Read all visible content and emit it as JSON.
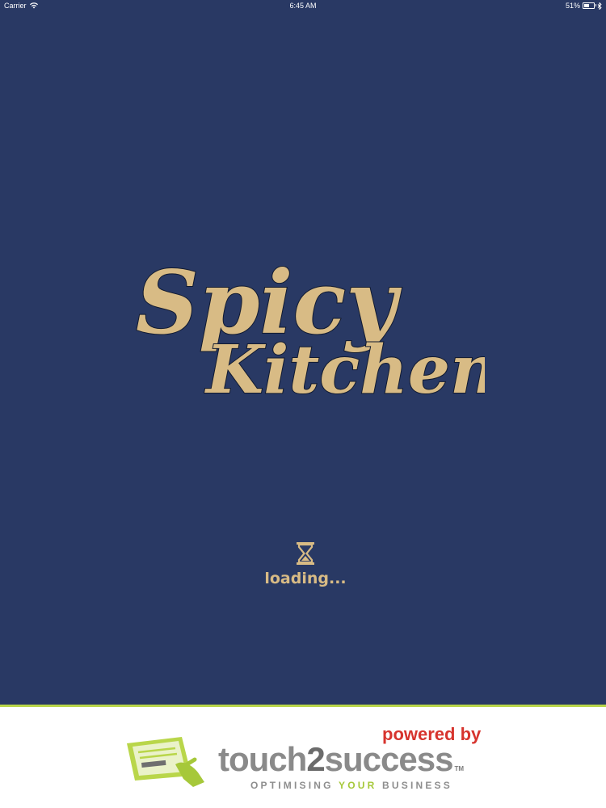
{
  "status_bar": {
    "carrier": "Carrier",
    "time": "6:45 AM",
    "battery_percent": "51%",
    "battery_level": 0.51,
    "wifi_icon": "wifi-icon",
    "bluetooth_icon": "bluetooth-icon"
  },
  "logo": {
    "line1": "Spicy",
    "line2": "Kitchen",
    "color": "#d8bb85",
    "background": "#293964"
  },
  "loading": {
    "icon": "hourglass-icon",
    "text": "loading..."
  },
  "footer": {
    "powered_by": "powered by",
    "brand_part1": "touch",
    "brand_part2": "2",
    "brand_part3": "success",
    "trademark": "TM",
    "tagline_pre": "OPTIMISING ",
    "tagline_accent": "YOUR",
    "tagline_post": " BUSINESS",
    "accent_color": "#b9d64a",
    "powered_color": "#d7342e"
  }
}
